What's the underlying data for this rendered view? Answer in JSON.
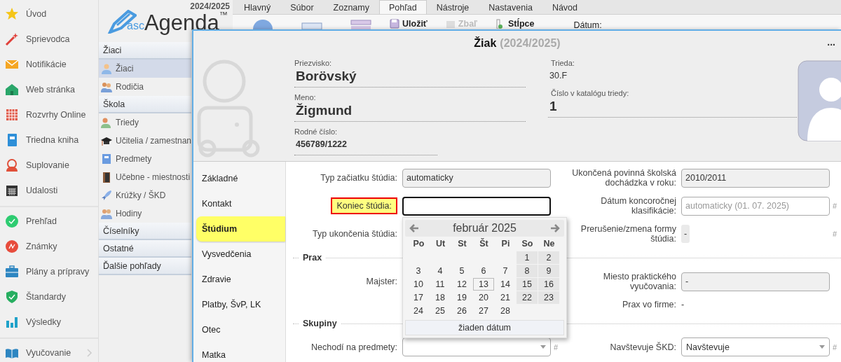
{
  "sidebar": {
    "groups": [
      {
        "items": [
          {
            "label": "Úvod",
            "submenu": false
          },
          {
            "label": "Sprievodca",
            "submenu": false
          },
          {
            "label": "Notifikácie",
            "submenu": false
          },
          {
            "label": "Web stránka",
            "submenu": false
          },
          {
            "label": "Rozvrhy Online",
            "submenu": false
          },
          {
            "label": "Triedna kniha",
            "submenu": false
          },
          {
            "label": "Suplovanie",
            "submenu": false
          },
          {
            "label": "Udalosti",
            "submenu": false
          }
        ]
      },
      {
        "items": [
          {
            "label": "Prehľad",
            "submenu": false
          },
          {
            "label": "Známky",
            "submenu": false
          },
          {
            "label": "Plány a prípravy",
            "submenu": false
          },
          {
            "label": "Štandardy",
            "submenu": false
          },
          {
            "label": "Výsledky",
            "submenu": false
          }
        ]
      },
      {
        "items": [
          {
            "label": "Vyučovanie",
            "submenu": true
          }
        ]
      }
    ]
  },
  "agenda": {
    "year": "2024/2025",
    "logo_prefix": "asc",
    "logo_name": "Agenda",
    "logo_mark": "™",
    "sections": [
      {
        "title": "Žiaci",
        "items": [
          {
            "label": "Žiaci",
            "selected": true
          },
          {
            "label": "Rodičia",
            "selected": false
          }
        ]
      },
      {
        "title": "Škola",
        "items": [
          {
            "label": "Triedy",
            "selected": false
          },
          {
            "label": "Učitelia / zamestnan",
            "selected": false
          },
          {
            "label": "Predmety",
            "selected": false
          },
          {
            "label": "Učebne - miestnosti",
            "selected": false
          },
          {
            "label": "Krúžky / ŠKD",
            "selected": false
          },
          {
            "label": "Hodiny",
            "selected": false
          }
        ]
      },
      {
        "title": "Číselníky"
      },
      {
        "title": "Ostatné"
      },
      {
        "title": "Ďalšie pohľady"
      }
    ]
  },
  "ribbon": {
    "tabs": [
      {
        "label": "Hlavný",
        "selected": false
      },
      {
        "label": "Súbor",
        "selected": false
      },
      {
        "label": "Zoznamy",
        "selected": false
      },
      {
        "label": "Pohľad",
        "selected": true
      },
      {
        "label": "Nástroje",
        "selected": false
      },
      {
        "label": "Nastavenia",
        "selected": false
      },
      {
        "label": "Návod",
        "selected": false
      }
    ],
    "buttons": [
      {
        "label": "Uložiť",
        "disabled": false
      },
      {
        "label": "Zbaľ",
        "disabled": true
      },
      {
        "label": "Stĺpce",
        "disabled": false
      }
    ],
    "date_label": "Dátum:"
  },
  "dialog": {
    "title": "Žiak",
    "subtitle": "(2024/2025)",
    "menu": "...",
    "header": {
      "left": [
        {
          "label": "Priezvisko:",
          "value": "Borövský",
          "kind": "large"
        },
        {
          "label": "Meno:",
          "value": "Žigmund",
          "kind": "large"
        },
        {
          "label": "Rodné číslo:",
          "value": "456789/1222",
          "kind": "medium"
        }
      ],
      "right": [
        {
          "label": "Trieda:",
          "value": "30.F",
          "kind": "plain"
        },
        {
          "label": "Číslo v katalógu triedy:",
          "value": "1",
          "kind": "large"
        }
      ]
    },
    "tabs": [
      {
        "label": "Základné",
        "selected": false
      },
      {
        "label": "Kontakt",
        "selected": false
      },
      {
        "label": "Štúdium",
        "selected": true
      },
      {
        "label": "Vysvedčenia",
        "selected": false
      },
      {
        "label": "Zdravie",
        "selected": false
      },
      {
        "label": "Platby, ŠvP, LK",
        "selected": false
      },
      {
        "label": "Otec",
        "selected": false
      },
      {
        "label": "Matka",
        "selected": false
      }
    ],
    "form": [
      {
        "kind": "row",
        "left": {
          "label": "Typ začiatku štúdia:",
          "kind": "value",
          "value": "automaticky",
          "highlighted": false
        },
        "right": {
          "label": "Ukončená povinná školská dochádzka v roku:",
          "kind": "value",
          "value": "2010/2011",
          "highlighted": false
        }
      },
      {
        "kind": "row",
        "left": {
          "label": "Koniec štúdia:",
          "kind": "input",
          "focused": true,
          "highlighted": true,
          "calendar": {
            "month": "február 2025",
            "weekdays": [
              "Po",
              "Ut",
              "St",
              "Št",
              "Pi",
              "So",
              "Ne"
            ],
            "weeks": [
              {
                "starts_mid_week": true,
                "days": [
                  {
                    "day": "1",
                    "weekend": true,
                    "today": false
                  },
                  {
                    "day": "2",
                    "weekend": true,
                    "today": false
                  }
                ]
              },
              {
                "starts_mid_week": false,
                "days": [
                  {
                    "day": "3",
                    "weekend": false,
                    "today": false
                  },
                  {
                    "day": "4",
                    "weekend": false,
                    "today": false
                  },
                  {
                    "day": "5",
                    "weekend": false,
                    "today": false
                  },
                  {
                    "day": "6",
                    "weekend": false,
                    "today": false
                  },
                  {
                    "day": "7",
                    "weekend": false,
                    "today": false
                  },
                  {
                    "day": "8",
                    "weekend": true,
                    "today": false
                  },
                  {
                    "day": "9",
                    "weekend": true,
                    "today": false
                  }
                ]
              },
              {
                "starts_mid_week": false,
                "days": [
                  {
                    "day": "10",
                    "weekend": false,
                    "today": false
                  },
                  {
                    "day": "11",
                    "weekend": false,
                    "today": false
                  },
                  {
                    "day": "12",
                    "weekend": false,
                    "today": false
                  },
                  {
                    "day": "13",
                    "weekend": false,
                    "today": true
                  },
                  {
                    "day": "14",
                    "weekend": false,
                    "today": false
                  },
                  {
                    "day": "15",
                    "weekend": true,
                    "today": false
                  },
                  {
                    "day": "16",
                    "weekend": true,
                    "today": false
                  }
                ]
              },
              {
                "starts_mid_week": false,
                "days": [
                  {
                    "day": "17",
                    "weekend": false,
                    "today": false
                  },
                  {
                    "day": "18",
                    "weekend": false,
                    "today": false
                  },
                  {
                    "day": "19",
                    "weekend": false,
                    "today": false
                  },
                  {
                    "day": "20",
                    "weekend": false,
                    "today": false
                  },
                  {
                    "day": "21",
                    "weekend": false,
                    "today": false
                  },
                  {
                    "day": "22",
                    "weekend": true,
                    "today": false
                  },
                  {
                    "day": "23",
                    "weekend": true,
                    "today": false
                  }
                ]
              },
              {
                "starts_mid_week": false,
                "days": [
                  {
                    "day": "24",
                    "weekend": false,
                    "today": false
                  },
                  {
                    "day": "25",
                    "weekend": false,
                    "today": false
                  },
                  {
                    "day": "26",
                    "weekend": false,
                    "today": false
                  },
                  {
                    "day": "27",
                    "weekend": false,
                    "today": false
                  },
                  {
                    "day": "28",
                    "weekend": false,
                    "today": false
                  }
                ]
              }
            ],
            "clear": "žiaden dátum"
          }
        },
        "right": {
          "label": "Dátum koncoročnej klasifikácie:",
          "kind": "input",
          "placeholder": "automaticky (01. 07. 2025)",
          "focused": false,
          "highlighted": false,
          "suffix": "#"
        }
      },
      {
        "kind": "row",
        "left": {
          "label": "Typ ukončenia štúdia:",
          "kind": "none",
          "highlighted": false
        },
        "right": {
          "label": "Prerušenie/zmena formy štúdia:",
          "kind": "chip",
          "value": "-",
          "highlighted": false,
          "suffix": "#"
        }
      },
      {
        "kind": "section",
        "title": "Prax"
      },
      {
        "kind": "row",
        "left": {
          "label": "Majster:",
          "kind": "none",
          "highlighted": false
        },
        "right": {
          "label": "Miesto praktického vyučovania:",
          "kind": "value",
          "value": "-",
          "highlighted": false
        }
      },
      {
        "kind": "row",
        "right": {
          "label": "Prax vo firme:",
          "kind": "text",
          "value": "-",
          "highlighted": false
        }
      },
      {
        "kind": "section",
        "title": "Skupiny"
      },
      {
        "kind": "row",
        "left": {
          "label": "Nechodí na predmety:",
          "kind": "select",
          "highlighted": false,
          "suffix": "#"
        },
        "right": {
          "label": "Navštevuje ŠKD:",
          "kind": "select",
          "value": "Navštevuje",
          "highlighted": false,
          "suffix": "#"
        }
      }
    ]
  }
}
